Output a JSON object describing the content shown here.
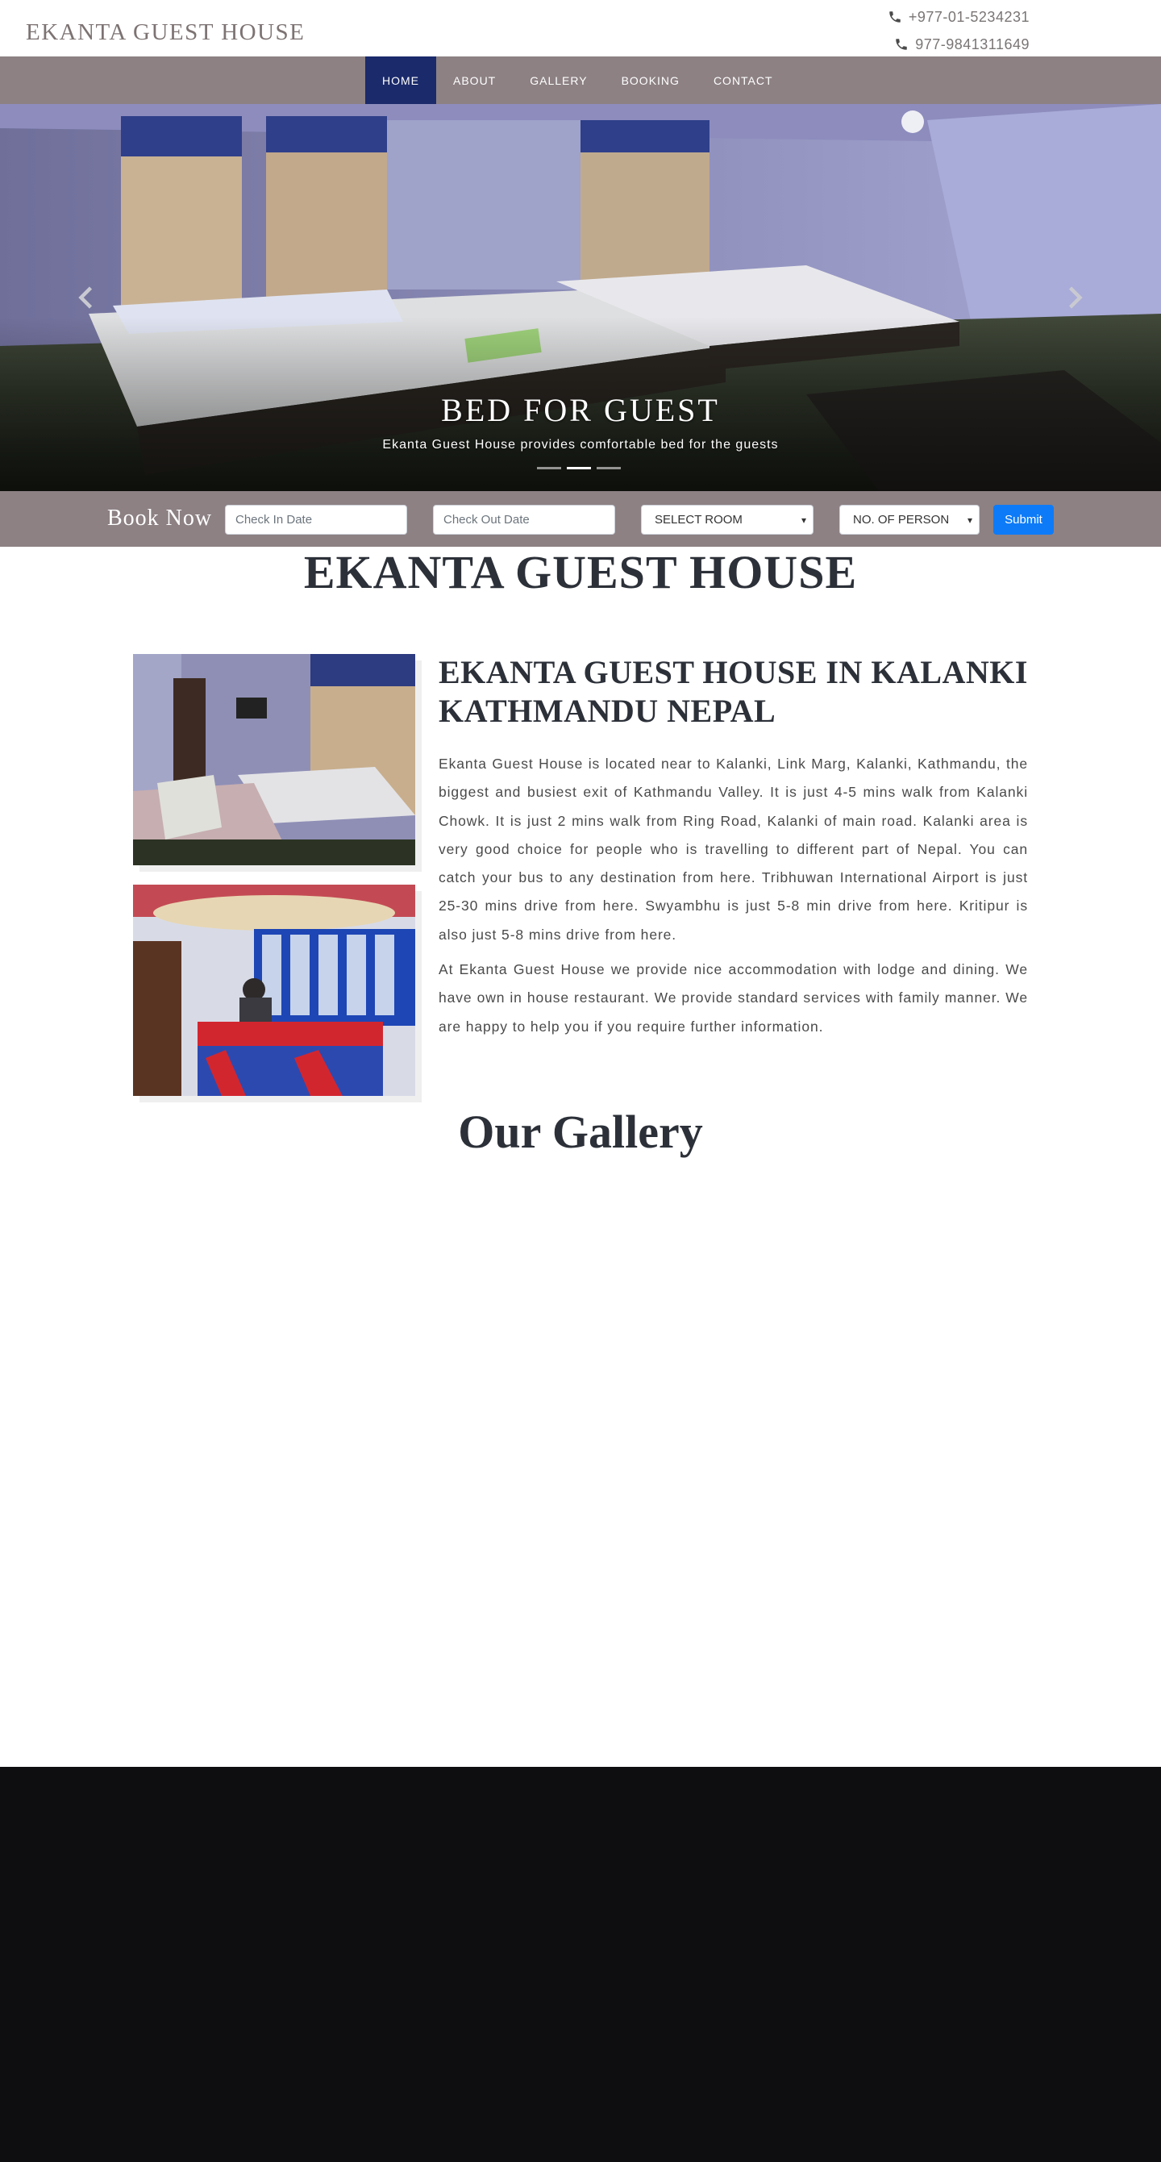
{
  "header": {
    "brand": "EKANTA GUEST HOUSE",
    "phones": [
      "+977-01-5234231",
      "977-9841311649"
    ]
  },
  "nav": {
    "items": [
      "HOME",
      "ABOUT",
      "GALLERY",
      "BOOKING",
      "CONTACT"
    ],
    "active": "HOME"
  },
  "hero": {
    "slide_title": "BED FOR GUEST",
    "slide_subtitle": "Ekanta Guest House provides comfortable bed for the guests",
    "indicator_count": 3,
    "active_indicator": 1
  },
  "booking": {
    "label": "Book Now",
    "check_in_placeholder": "Check In Date",
    "check_out_placeholder": "Check Out Date",
    "room_select": "SELECT ROOM",
    "person_select": "NO. OF PERSON",
    "submit_label": "Submit"
  },
  "about": {
    "page_title": "EKANTA GUEST HOUSE",
    "heading": "EKANTA GUEST HOUSE IN KALANKI KATHMANDU NEPAL",
    "paragraph1": "Ekanta Guest House is located near to Kalanki, Link Marg, Kalanki, Kathmandu, the biggest and busiest exit of Kathmandu Valley. It is just 4-5 mins walk from Kalanki Chowk. It is just 2 mins walk from Ring Road, Kalanki of main road. Kalanki area is very good choice for people who is travelling to different part of Nepal. You can catch your bus to any destination from here. Tribhuwan International Airport is just 25-30 mins drive from here. Swyambhu is just 5-8 min drive from here. Kritipur is also just 5-8 mins drive from here.",
    "paragraph2": "At Ekanta Guest House we provide nice accommodation with lodge and dining. We have own in house restaurant. We provide standard services with family manner. We are happy to help you if you require further information."
  },
  "gallery": {
    "title": "Our Gallery"
  },
  "colors": {
    "nav_bg": "#8d8184",
    "nav_active": "#1b2a6b",
    "submit_blue": "#0d7bf7",
    "footer_bg": "#0e0e11",
    "heading_text": "#2c3038"
  },
  "icons": {
    "phone": "phone-icon",
    "prev": "chevron-left-icon",
    "next": "chevron-right-icon"
  }
}
